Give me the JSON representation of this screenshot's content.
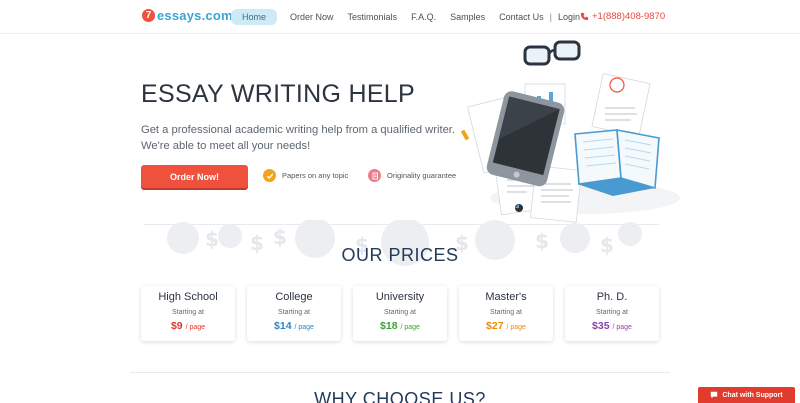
{
  "header": {
    "logo_badge": "7",
    "logo_text": "essays.com",
    "nav": [
      {
        "label": "Home",
        "active": true
      },
      {
        "label": "Order Now"
      },
      {
        "label": "Testimonials"
      },
      {
        "label": "F.A.Q."
      },
      {
        "label": "Samples"
      },
      {
        "label": "Contact Us"
      },
      {
        "label": "Login"
      }
    ],
    "nav_separator": "|",
    "phone": "+1(888)408-9870"
  },
  "hero": {
    "title": "ESSAY WRITING HELP",
    "subtitle_line1": "Get a professional academic writing help from a qualified writer.",
    "subtitle_line2": "We're able to meet all your needs!",
    "order_button": "Order Now!",
    "features": [
      {
        "icon": "check-badge-icon",
        "label": "Papers on any topic",
        "color": "#f3a21b"
      },
      {
        "icon": "document-badge-icon",
        "label": "Originality guarantee",
        "color": "#f07c8a"
      }
    ]
  },
  "prices": {
    "title": "OUR PRICES",
    "starting_label": "Starting at",
    "per_page_label": "/ page",
    "cards": [
      {
        "name": "High School",
        "price": "$9",
        "color": "#e2352e"
      },
      {
        "name": "College",
        "price": "$14",
        "color": "#2e86c8"
      },
      {
        "name": "University",
        "price": "$18",
        "color": "#3fa134"
      },
      {
        "name": "Master's",
        "price": "$27",
        "color": "#ec8a0c"
      },
      {
        "name": "Ph. D.",
        "price": "$35",
        "color": "#8e44ad"
      }
    ]
  },
  "why": {
    "title": "WHY CHOOSE US?"
  },
  "chat": {
    "label": "Chat with Support",
    "icon": "chat-bubble-icon"
  },
  "colors": {
    "brand_red": "#f0513d",
    "brand_blue": "#3aa5d6",
    "heading_navy": "#233b58"
  }
}
